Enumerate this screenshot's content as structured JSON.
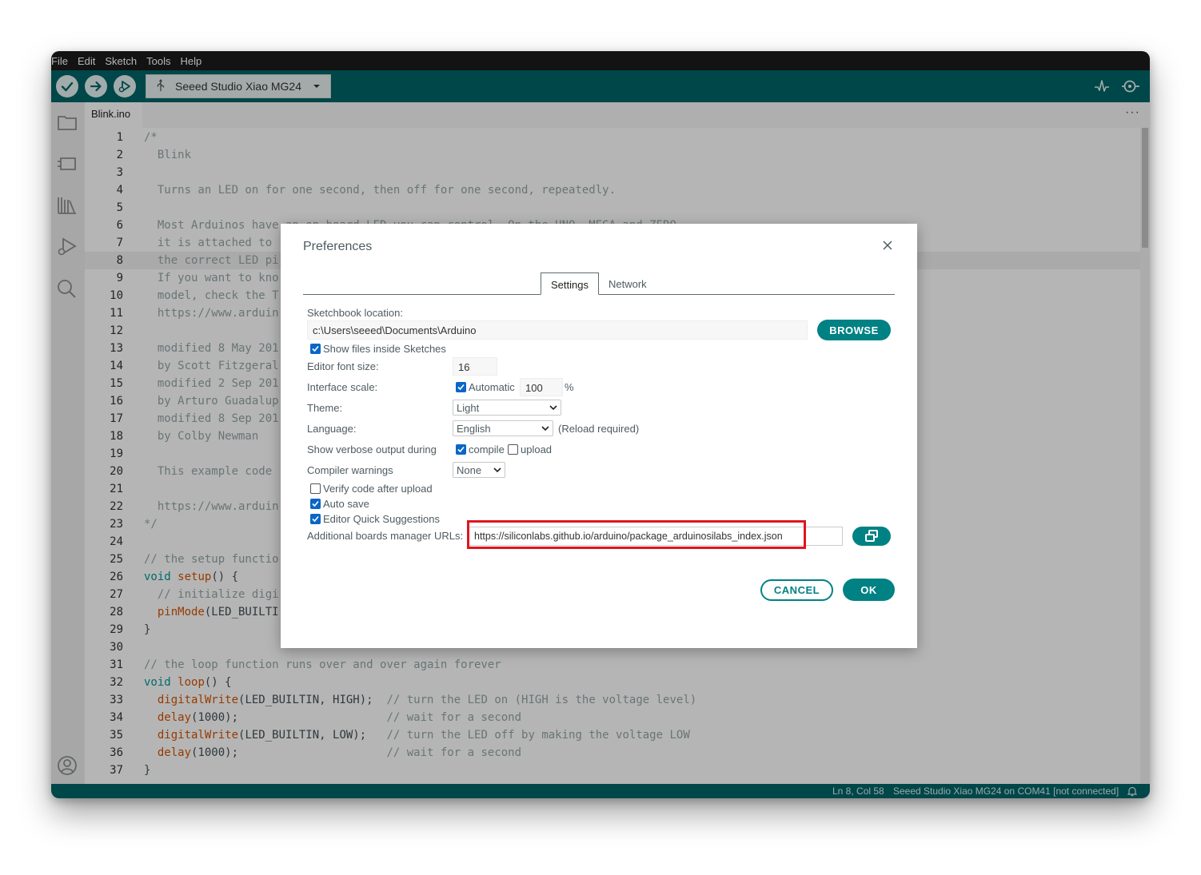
{
  "menu": [
    "File",
    "Edit",
    "Sketch",
    "Tools",
    "Help"
  ],
  "toolbar": {
    "board": "Seeed Studio Xiao MG24",
    "icons": [
      "verify-icon",
      "upload-icon",
      "debug-icon",
      "serial-plotter-icon",
      "serial-monitor-icon"
    ]
  },
  "tab": {
    "name": "Blink.ino"
  },
  "editor": {
    "current_line": 8,
    "lines": [
      [
        [
          "c-comment",
          "/*"
        ]
      ],
      [
        [
          "c-comment",
          "  Blink"
        ]
      ],
      [
        [
          "c-comment",
          ""
        ]
      ],
      [
        [
          "c-comment",
          "  Turns an LED on for one second, then off for one second, repeatedly."
        ]
      ],
      [
        [
          "c-comment",
          ""
        ]
      ],
      [
        [
          "c-comment",
          "  Most Arduinos have an on-board LED you can control. On the UNO, MEGA and ZERO"
        ]
      ],
      [
        [
          "c-comment",
          "  it is attached to"
        ]
      ],
      [
        [
          "c-comment",
          "  the correct LED pi"
        ]
      ],
      [
        [
          "c-comment",
          "  If you want to kno"
        ]
      ],
      [
        [
          "c-comment",
          "  model, check the T"
        ]
      ],
      [
        [
          "c-comment",
          "  https://www.arduin"
        ]
      ],
      [
        [
          "c-comment",
          ""
        ]
      ],
      [
        [
          "c-comment",
          "  modified 8 May 201"
        ]
      ],
      [
        [
          "c-comment",
          "  by Scott Fitzgeral"
        ]
      ],
      [
        [
          "c-comment",
          "  modified 2 Sep 201"
        ]
      ],
      [
        [
          "c-comment",
          "  by Arturo Guadalup"
        ]
      ],
      [
        [
          "c-comment",
          "  modified 8 Sep 201"
        ]
      ],
      [
        [
          "c-comment",
          "  by Colby Newman"
        ]
      ],
      [
        [
          "c-comment",
          ""
        ]
      ],
      [
        [
          "c-comment",
          "  This example code"
        ]
      ],
      [
        [
          "c-comment",
          ""
        ]
      ],
      [
        [
          "c-comment",
          "  https://www.arduin"
        ]
      ],
      [
        [
          "c-comment",
          "*/"
        ]
      ],
      [
        [
          "c-txt",
          ""
        ]
      ],
      [
        [
          "c-comment",
          "// the setup functio"
        ]
      ],
      [
        [
          "c-kw",
          "void "
        ],
        [
          "c-fn",
          "setup"
        ],
        [
          "c-txt",
          "() {"
        ]
      ],
      [
        [
          "c-comment",
          "  // initialize digi"
        ]
      ],
      [
        [
          "c-fn",
          "  pinMode"
        ],
        [
          "c-txt",
          "(LED_BUILTI"
        ]
      ],
      [
        [
          "c-txt",
          "}"
        ]
      ],
      [
        [
          "c-txt",
          ""
        ]
      ],
      [
        [
          "c-comment",
          "// the loop function runs over and over again forever"
        ]
      ],
      [
        [
          "c-kw",
          "void "
        ],
        [
          "c-fn",
          "loop"
        ],
        [
          "c-txt",
          "() {"
        ]
      ],
      [
        [
          "c-fn",
          "  digitalWrite"
        ],
        [
          "c-txt",
          "(LED_BUILTIN, HIGH);  "
        ],
        [
          "c-comment",
          "// turn the LED on (HIGH is the voltage level)"
        ]
      ],
      [
        [
          "c-fn",
          "  delay"
        ],
        [
          "c-txt",
          "(1000);                      "
        ],
        [
          "c-comment",
          "// wait for a second"
        ]
      ],
      [
        [
          "c-fn",
          "  digitalWrite"
        ],
        [
          "c-txt",
          "(LED_BUILTIN, LOW);   "
        ],
        [
          "c-comment",
          "// turn the LED off by making the voltage LOW"
        ]
      ],
      [
        [
          "c-fn",
          "  delay"
        ],
        [
          "c-txt",
          "(1000);                      "
        ],
        [
          "c-comment",
          "// wait for a second"
        ]
      ],
      [
        [
          "c-txt",
          "}"
        ]
      ]
    ]
  },
  "status": {
    "position": "Ln 8, Col 58",
    "board": "Seeed Studio Xiao MG24 on COM41 [not connected]"
  },
  "dialog": {
    "title": "Preferences",
    "tabs": [
      "Settings",
      "Network"
    ],
    "active_tab": "Settings",
    "sketchbook_label": "Sketchbook location:",
    "sketchbook_value": "c:\\Users\\seeed\\Documents\\Arduino",
    "browse_label": "BROWSE",
    "show_files_label": "Show files inside Sketches",
    "show_files_checked": true,
    "font_size_label": "Editor font size:",
    "font_size_value": "16",
    "scale_label": "Interface scale:",
    "scale_auto_label": "Automatic",
    "scale_auto_checked": true,
    "scale_value": "100",
    "scale_unit": "%",
    "theme_label": "Theme:",
    "theme_value": "Light",
    "language_label": "Language:",
    "language_value": "English",
    "language_note": "(Reload required)",
    "verbose_label": "Show verbose output during",
    "compile_label": "compile",
    "compile_checked": true,
    "upload_label": "upload",
    "upload_checked": false,
    "warnings_label": "Compiler warnings",
    "warnings_value": "None",
    "verify_label": "Verify code after upload",
    "verify_checked": false,
    "autosave_label": "Auto save",
    "autosave_checked": true,
    "quick_suggestions_label": "Editor Quick Suggestions",
    "quick_suggestions_checked": true,
    "boards_urls_label": "Additional boards manager URLs:",
    "boards_urls_value": "https://siliconlabs.github.io/arduino/package_arduinosilabs_index.json",
    "cancel_label": "CANCEL",
    "ok_label": "OK",
    "highlight_color": "#e0151c"
  },
  "colors": {
    "teal": "#006468",
    "accent": "#008184",
    "checkbox": "#0a67c6"
  }
}
